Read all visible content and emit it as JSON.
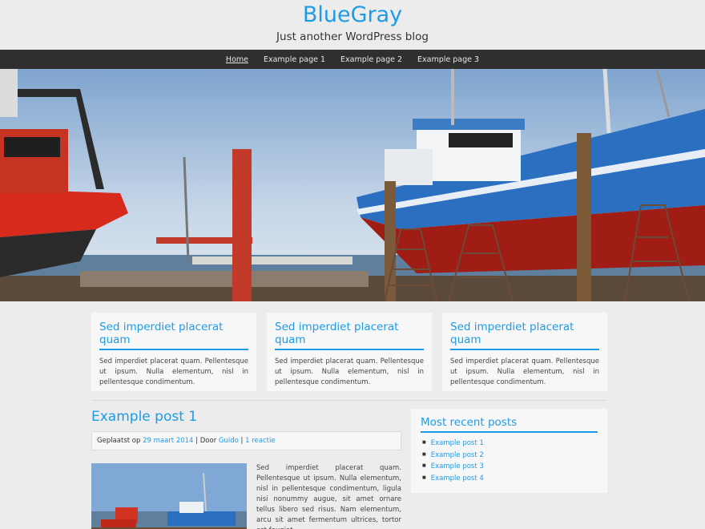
{
  "site": {
    "title": "BlueGray",
    "tagline": "Just another WordPress blog"
  },
  "nav": {
    "items": [
      "Home",
      "Example page 1",
      "Example page 2",
      "Example page 3"
    ],
    "active": "Home"
  },
  "features": [
    {
      "title": "Sed imperdiet placerat quam",
      "text": "Sed imperdiet placerat quam. Pellentesque ut ipsum. Nulla elementum, nisl in pellentesque condimentum."
    },
    {
      "title": "Sed imperdiet placerat quam",
      "text": "Sed imperdiet placerat quam. Pellentesque ut ipsum. Nulla elementum, nisl in pellentesque condimentum."
    },
    {
      "title": "Sed imperdiet placerat quam",
      "text": "Sed imperdiet placerat quam. Pellentesque ut ipsum. Nulla elementum, nisl in pellentesque condimentum."
    }
  ],
  "post": {
    "title": "Example post 1",
    "meta_prefix": "Geplaatst op",
    "date": "29 maart 2014",
    "by_label": "| Door",
    "author": "Guido",
    "sep": "|",
    "comments": "1 reactie",
    "excerpt": "Sed imperdiet placerat quam. Pellentesque ut ipsum. Nulla elementum, nisl in pellentesque condimentum, ligula nisi nonummy augue, sit amet ornare tellus libero sed risus. Nam elementum, arcu sit amet fermentum ultrices, tortor est feugiat"
  },
  "sidebar": {
    "widget_title": "Most recent posts",
    "posts": [
      "Example post 1",
      "Example post 2",
      "Example post 3",
      "Example post 4"
    ]
  },
  "colors": {
    "accent": "#1e9be6",
    "nav_bg": "#2f2f2f",
    "page_bg": "#ececec"
  }
}
